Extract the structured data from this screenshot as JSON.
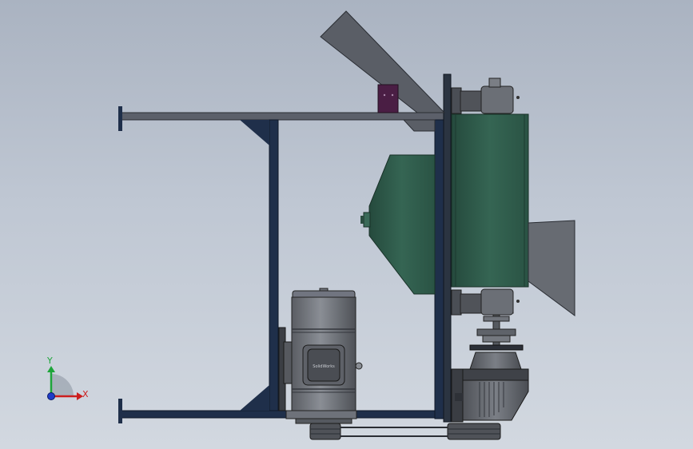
{
  "view": {
    "axis_triad": {
      "y_label": "Y",
      "x_label": "X"
    },
    "motor": {
      "nameplate_text": "SolidWorks"
    },
    "colors": {
      "background_top": "#aab3c1",
      "background_bottom": "#d2d8e0",
      "frame_steel": "#1f2f4a",
      "top_rail": "#5c606a",
      "green_housing": "#2f5a4b",
      "gray_parts": "#676b72",
      "hopper_block": "#4a1e44",
      "axis_x": "#cc1e1e",
      "axis_y": "#1ea53a",
      "axis_z": "#1e3cc8"
    }
  }
}
